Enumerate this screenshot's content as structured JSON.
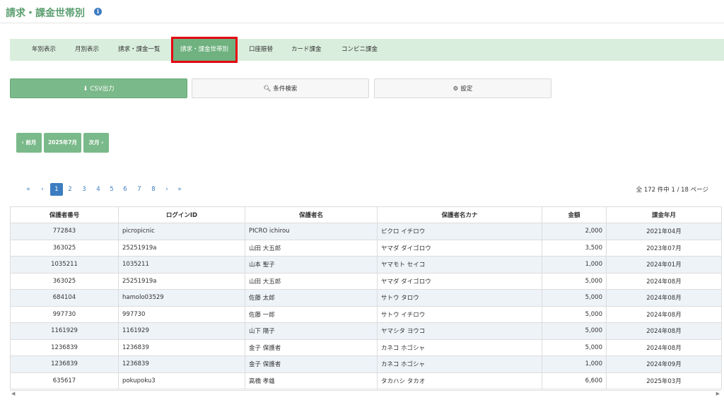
{
  "page": {
    "title": "請求・課金世帯別",
    "info_icon": "info-icon"
  },
  "tabs": [
    {
      "label": "年別表示"
    },
    {
      "label": "月別表示"
    },
    {
      "label": "請求・課金一覧"
    },
    {
      "label": "請求・課金世帯別",
      "active": true
    },
    {
      "label": "口座振替"
    },
    {
      "label": "カード課金"
    },
    {
      "label": "コンビニ課金"
    }
  ],
  "actions": {
    "csv": {
      "label": "CSV出力",
      "icon": "download-icon"
    },
    "search": {
      "label": "条件検索",
      "icon": "search-icon"
    },
    "settings": {
      "label": "設定",
      "icon": "gear-icon"
    }
  },
  "month_nav": {
    "prev": "‹ 前月",
    "current": "2025年7月",
    "next": "次月 ›"
  },
  "pagination": {
    "first": "«",
    "prev": "‹",
    "pages": [
      "1",
      "2",
      "3",
      "4",
      "5",
      "6",
      "7",
      "8"
    ],
    "current": "1",
    "next": "›",
    "last": "»",
    "info": "全 172 件中 1 / 18 ページ"
  },
  "table": {
    "headers": [
      "保護者番号",
      "ログインID",
      "保護者名",
      "保護者名カナ",
      "金額",
      "課金年月"
    ],
    "rows": [
      [
        "772843",
        "picropicnic",
        "PICRO ichirou",
        "ピクロ イチロウ",
        "2,000",
        "2021年04月"
      ],
      [
        "363025",
        "25251919a",
        "山田 大五郎",
        "ヤマダ ダイゴロウ",
        "3,500",
        "2023年07月"
      ],
      [
        "1035211",
        "1035211",
        "山本 聖子",
        "ヤマモト セイコ",
        "1,000",
        "2024年01月"
      ],
      [
        "363025",
        "25251919a",
        "山田 大五郎",
        "ヤマダ ダイゴロウ",
        "5,000",
        "2024年08月"
      ],
      [
        "684104",
        "hamolo03529",
        "佐藤 太郎",
        "サトウ タロウ",
        "5,000",
        "2024年08月"
      ],
      [
        "997730",
        "997730",
        "佐藤 一郎",
        "サトウ イチロウ",
        "5,000",
        "2024年08月"
      ],
      [
        "1161929",
        "1161929",
        "山下 陽子",
        "ヤマシタ ヨウコ",
        "5,000",
        "2024年08月"
      ],
      [
        "1236839",
        "1236839",
        "金子 保護者",
        "カネコ ホゴシャ",
        "5,000",
        "2024年08月"
      ],
      [
        "1236839",
        "1236839",
        "金子 保護者",
        "カネコ ホゴシャ",
        "1,000",
        "2024年09月"
      ],
      [
        "635617",
        "pokupoku3",
        "高橋 孝雄",
        "タカハシ タカオ",
        "6,600",
        "2025年03月"
      ]
    ]
  }
}
